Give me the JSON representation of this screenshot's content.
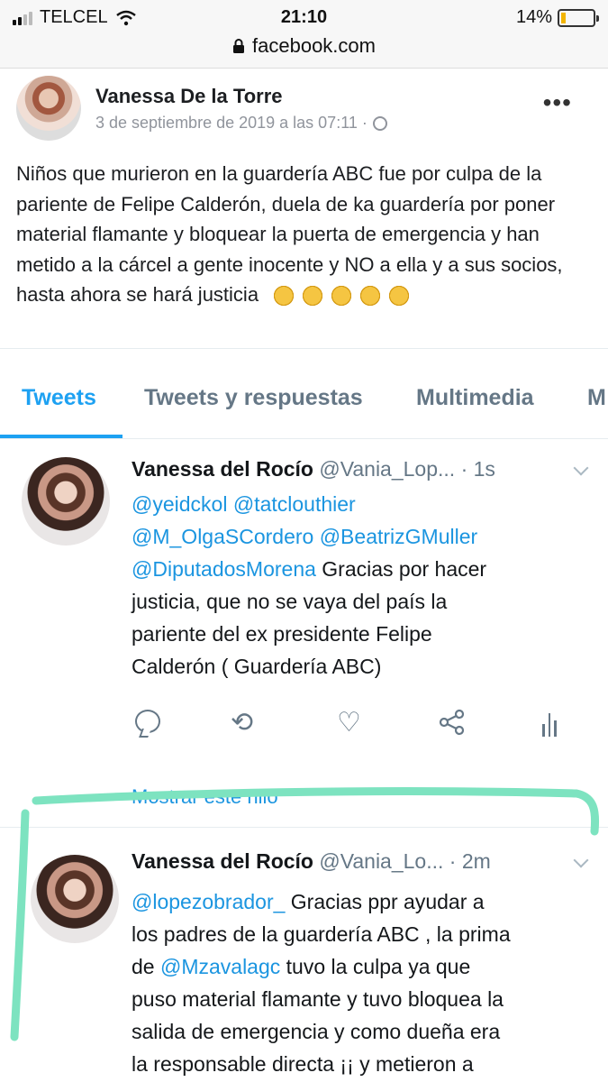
{
  "status_bar": {
    "carrier": "TELCEL",
    "time": "21:10",
    "battery": "14%",
    "icons": [
      "signal-icon",
      "wifi-icon",
      "battery-icon"
    ]
  },
  "browser": {
    "url": "facebook.com",
    "icons": [
      "lock-icon"
    ]
  },
  "facebook_post": {
    "author": "Vanessa De la Torre",
    "date": "3 de septiembre de 2019 a las 07:11 ·",
    "more_label": "•••",
    "text": "Niños que murieron en la guardería ABC fue por culpa de la pariente de Felipe Calderón, duela de ka guardería por poner material flamante y bloquear la puerta de emergencia y han metido a la cárcel a gente inocente y NO a ella y a sus socios, hasta ahora se hará justicia",
    "emoji_count": 5,
    "icons": [
      "globe-icon",
      "clapping-hands-icon"
    ]
  },
  "twitter": {
    "tabs": [
      {
        "label": "Tweets",
        "active": true
      },
      {
        "label": "Tweets y respuestas",
        "active": false
      },
      {
        "label": "Multimedia",
        "active": false
      },
      {
        "label": "M",
        "active": false
      }
    ],
    "tweets": [
      {
        "name": "Vanessa del Rocío",
        "handle": "@Vania_Lop... · 1s",
        "mentions_line1": "@yeidckol @tatclouthier",
        "mentions_line2": "@M_OlgaSCordero @BeatrizGMuller",
        "mention3": "@DiputadosMorena",
        "text_after_mention3": " Gracias por hacer",
        "line4": "justicia,  que no se vaya del país la",
        "line5": "pariente del ex presidente Felipe",
        "line6": "Calderón ( Guardería ABC)",
        "thread_link": "Mostrar este hilo"
      },
      {
        "name": "Vanessa del Rocío",
        "handle": "@Vania_Lo... · 2m",
        "mention1": "@lopezobrador_",
        "text1": "  Gracias ppr ayudar a",
        "line2": "los padres de la guardería ABC , la prima",
        "line3_pre": "de ",
        "mention2": "@Mzavalagc",
        "line3_post": " tuvo la culpa ya que",
        "line4": "puso material flamante y tuvo bloquea la",
        "line5": "salida de emergencia y como dueña era",
        "line6": "la responsable directa ¡¡ y metieron a"
      }
    ],
    "action_icons": [
      "reply-icon",
      "retweet-icon",
      "like-icon",
      "share-icon",
      "analytics-icon"
    ]
  },
  "annotation": {
    "color": "#7de3c0"
  }
}
